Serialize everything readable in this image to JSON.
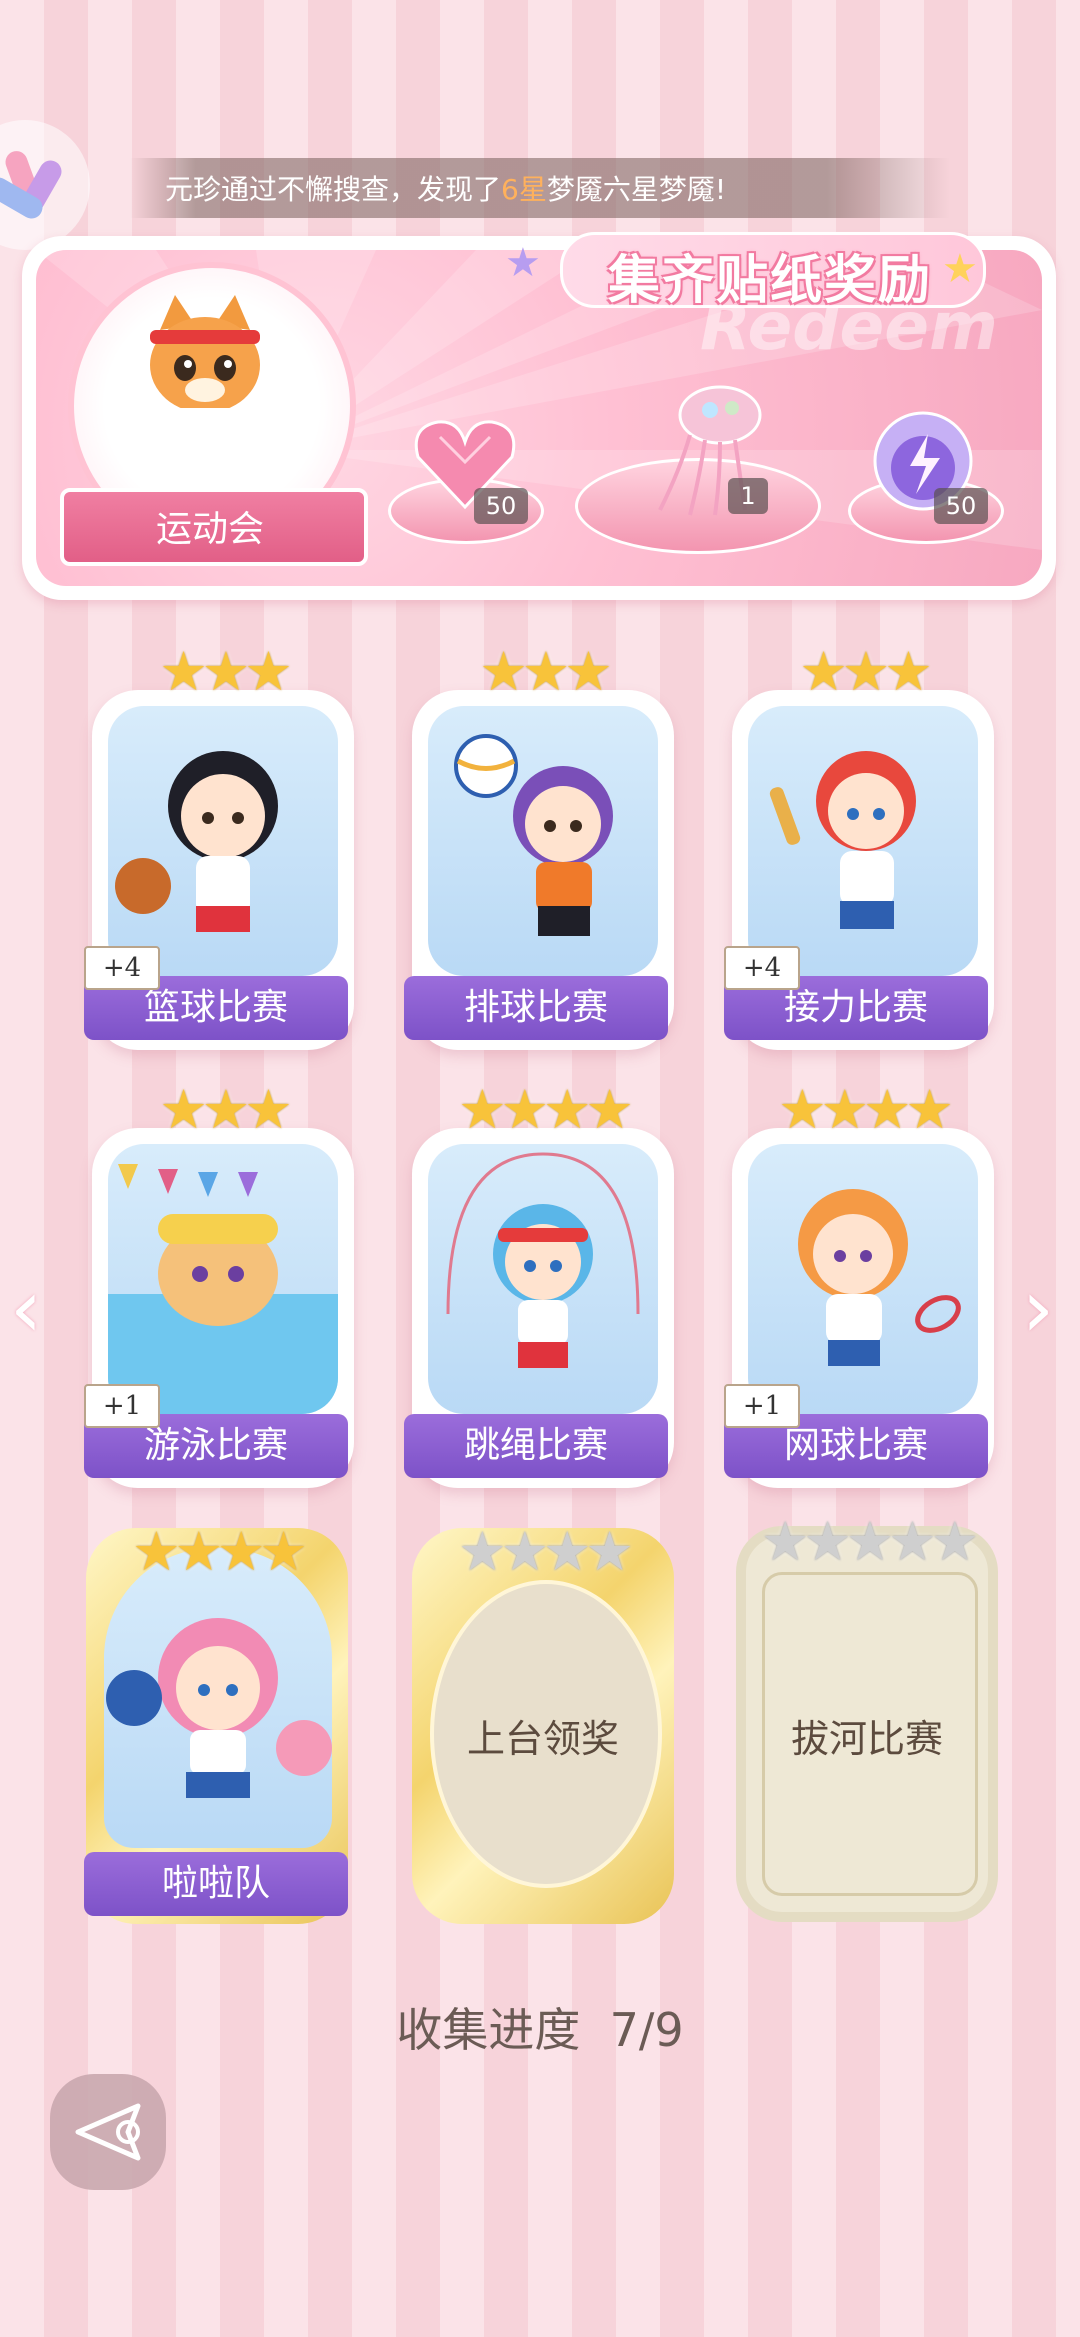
{
  "banner": {
    "prefix": "元珍通过不懈搜查，发现了",
    "highlight": "6星",
    "suffix": "梦魇六星梦魇!"
  },
  "reward_panel": {
    "title": "集齐贴纸奖励",
    "watermark": "Redeem",
    "badge_label": "运动会",
    "rewards": [
      {
        "icon": "pink-heart-gem-icon",
        "count": "50"
      },
      {
        "icon": "jellyfish-ornament-icon",
        "count": "1"
      },
      {
        "icon": "purple-orb-icon",
        "count": "50"
      }
    ]
  },
  "cards": [
    {
      "label": "篮球比赛",
      "stars": "★★★",
      "count": "+4"
    },
    {
      "label": "排球比赛",
      "stars": "★★★",
      "count": ""
    },
    {
      "label": "接力比赛",
      "stars": "★★★",
      "count": "+4"
    },
    {
      "label": "游泳比赛",
      "stars": "★★★",
      "count": "+1"
    },
    {
      "label": "跳绳比赛",
      "stars": "★★★★",
      "count": ""
    },
    {
      "label": "网球比赛",
      "stars": "★★★★",
      "count": "+1"
    },
    {
      "label": "啦啦队",
      "stars": "★★★★",
      "count": ""
    },
    {
      "label": "上台领奖",
      "stars": "★★★★",
      "count": ""
    },
    {
      "label": "拔河比赛",
      "stars": "★★★★★",
      "count": ""
    }
  ],
  "progress": {
    "label": "收集进度",
    "value": "7/9",
    "collected": 7,
    "total": 9
  },
  "colors": {
    "accent_purple": "#8a5ed2",
    "accent_pink": "#f07fa2",
    "star_gold": "#f8c33a",
    "star_gray": "#cfcfcf"
  }
}
